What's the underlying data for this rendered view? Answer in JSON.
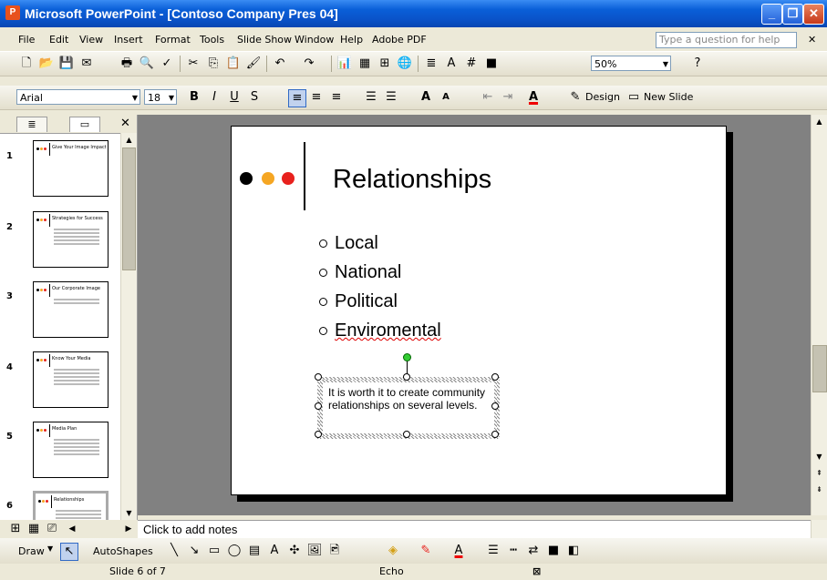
{
  "window": {
    "title": "Microsoft PowerPoint - [Contoso Company Pres 04]"
  },
  "menu": {
    "items": [
      "File",
      "Edit",
      "View",
      "Insert",
      "Format",
      "Tools",
      "Slide Show",
      "Window",
      "Help",
      "Adobe PDF"
    ],
    "ask_placeholder": "Type a question for help"
  },
  "toolbar": {
    "zoom": "50%"
  },
  "formatting": {
    "font": "Arial",
    "size": "18",
    "design_label": "Design",
    "new_slide_label": "New Slide"
  },
  "thumbnails": [
    {
      "num": "1",
      "title": "Give Your Image Impact"
    },
    {
      "num": "2",
      "title": "Strategies for Success"
    },
    {
      "num": "3",
      "title": "Our Corporate Image"
    },
    {
      "num": "4",
      "title": "Know Your Media"
    },
    {
      "num": "5",
      "title": "Media Plan"
    },
    {
      "num": "6",
      "title": "Relationships"
    }
  ],
  "slide": {
    "title": "Relationships",
    "bullets": [
      "Local",
      "National",
      "Political",
      "Enviromental"
    ],
    "textbox": "It is worth it to create community relationships on several levels."
  },
  "colors": {
    "dot1": "#000000",
    "dot2": "#f5a623",
    "dot3": "#e8211d"
  },
  "notes": {
    "placeholder": "Click to add notes"
  },
  "drawbar": {
    "draw": "Draw",
    "autoshapes": "AutoShapes"
  },
  "status": {
    "slide": "Slide 6 of 7",
    "design": "Echo"
  }
}
